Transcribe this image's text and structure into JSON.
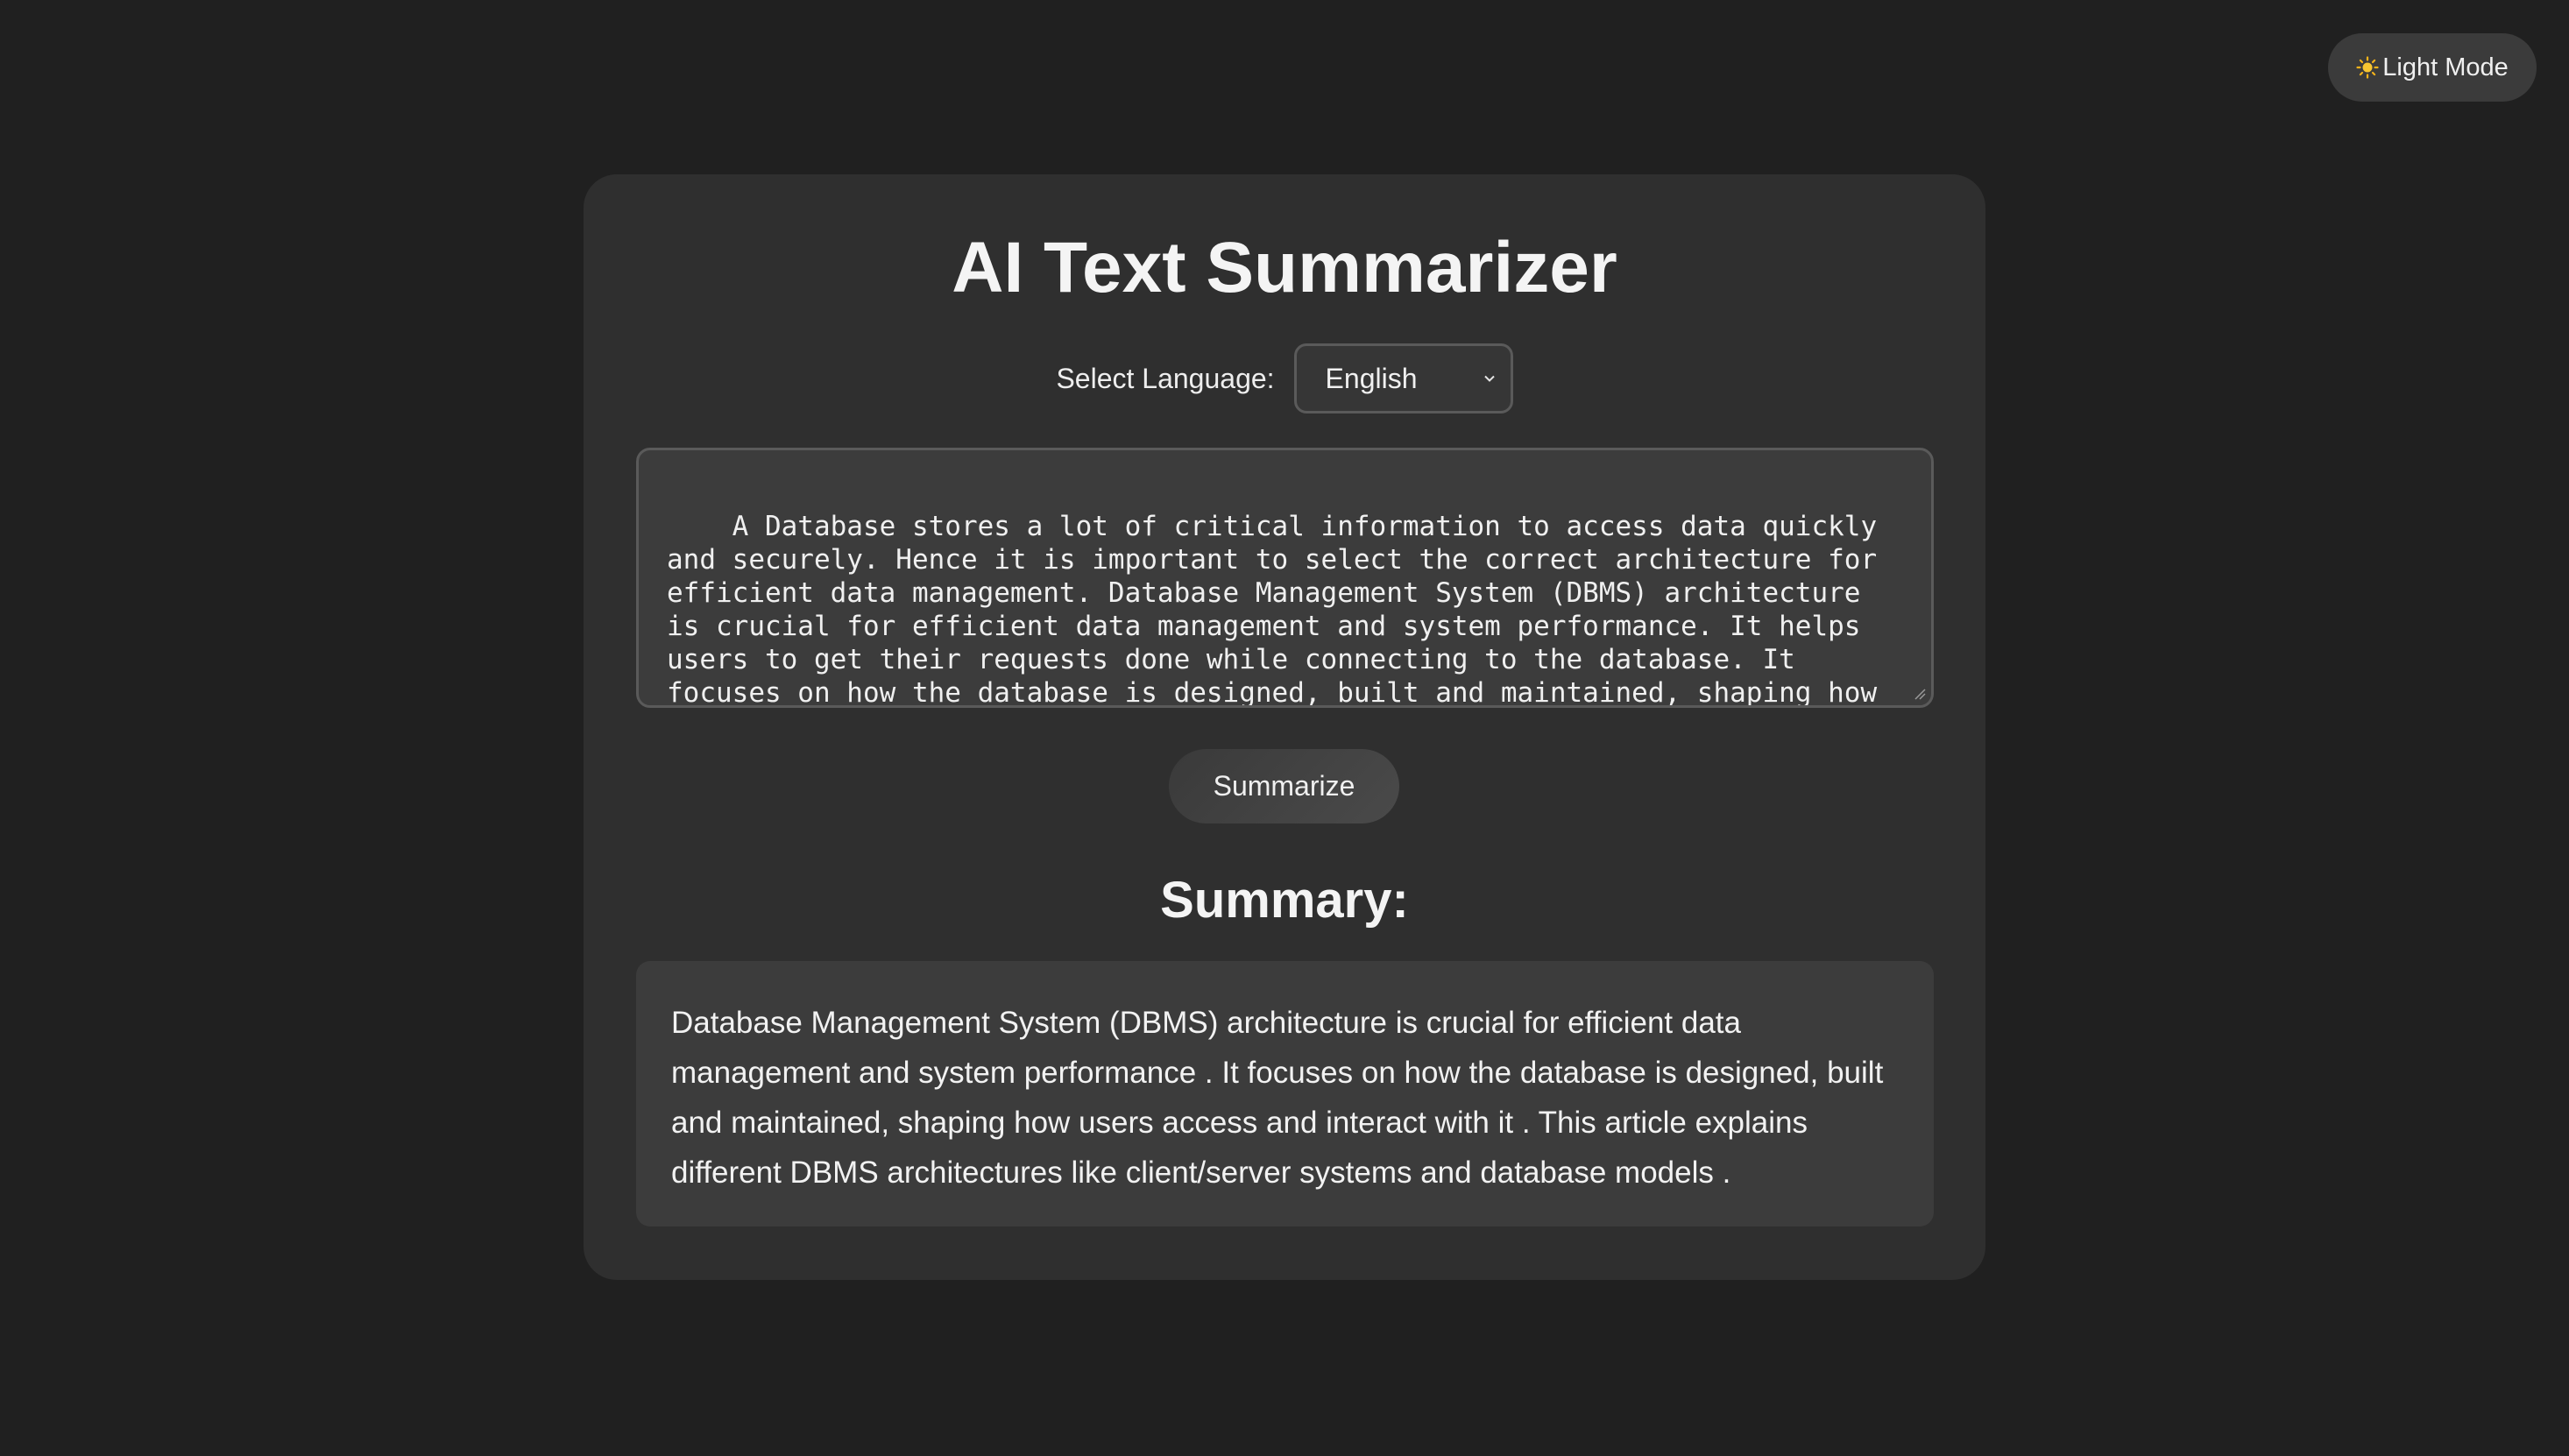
{
  "theme_toggle": {
    "icon": "sun-icon",
    "label": "Light Mode"
  },
  "app": {
    "title": "AI Text Summarizer"
  },
  "language": {
    "label": "Select Language:",
    "selected": "English"
  },
  "input": {
    "value": "A Database stores a lot of critical information to access data quickly and securely. Hence it is important to select the correct architecture for efficient data management. Database Management System (DBMS) architecture is crucial for efficient data management and system performance. It helps users to get their requests done while connecting to the database. It focuses on how the database is designed, built and maintained, shaping how users access and interact with it. This article"
  },
  "actions": {
    "summarize_label": "Summarize"
  },
  "summary": {
    "heading": "Summary:",
    "text": "Database Management System (DBMS) architecture is crucial for efficient data management and system performance . It focuses on how the database is designed, built and maintained, shaping how users access and interact with it . This article explains different DBMS architectures like client/server systems and database models ."
  }
}
